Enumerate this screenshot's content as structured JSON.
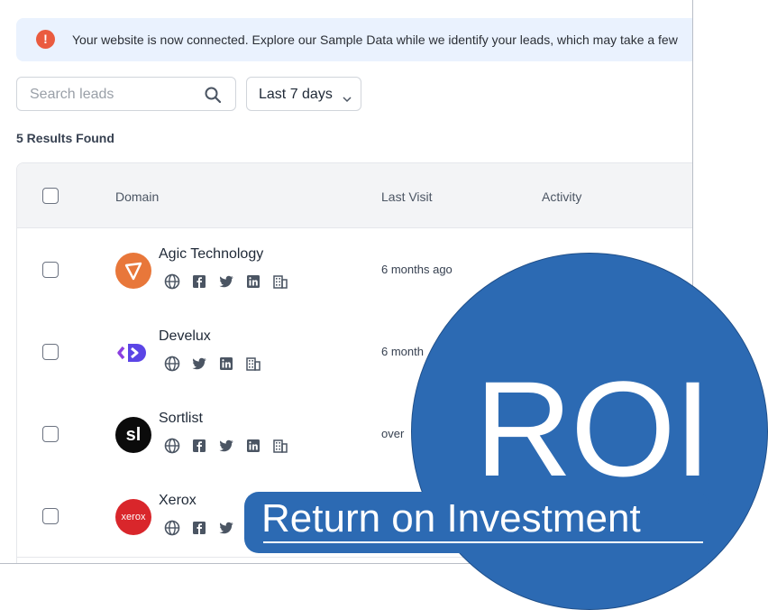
{
  "banner": {
    "message": "Your website is now connected. Explore our Sample Data while we identify your leads, which may take a few",
    "icon": "alert-circle-icon",
    "color": "#ea5b3f"
  },
  "search": {
    "placeholder": "Search leads",
    "icon": "search-icon"
  },
  "date_filter": {
    "selected": "Last 7 days"
  },
  "results_label": "5 Results Found",
  "table": {
    "columns": [
      "Domain",
      "Last Visit",
      "Activity"
    ],
    "rows": [
      {
        "name": "Agic Technology",
        "last_visit": "6 months ago",
        "socials": [
          "globe-icon",
          "facebook-icon",
          "twitter-icon",
          "linkedin-icon",
          "building-icon"
        ]
      },
      {
        "name": "Develux",
        "last_visit": "6 month",
        "socials": [
          "globe-icon",
          "twitter-icon",
          "linkedin-icon",
          "building-icon"
        ]
      },
      {
        "name": "Sortlist",
        "last_visit": "over",
        "socials": [
          "globe-icon",
          "facebook-icon",
          "twitter-icon",
          "linkedin-icon",
          "building-icon"
        ]
      },
      {
        "name": "Xerox",
        "last_visit": "",
        "socials": [
          "globe-icon",
          "facebook-icon",
          "twitter-icon"
        ]
      }
    ]
  },
  "roi": {
    "title": "ROI",
    "subtitle": "Return on Investment",
    "color": "#2c6ab3"
  },
  "logos": {
    "sortlist": "sl",
    "xerox": "xerox"
  }
}
